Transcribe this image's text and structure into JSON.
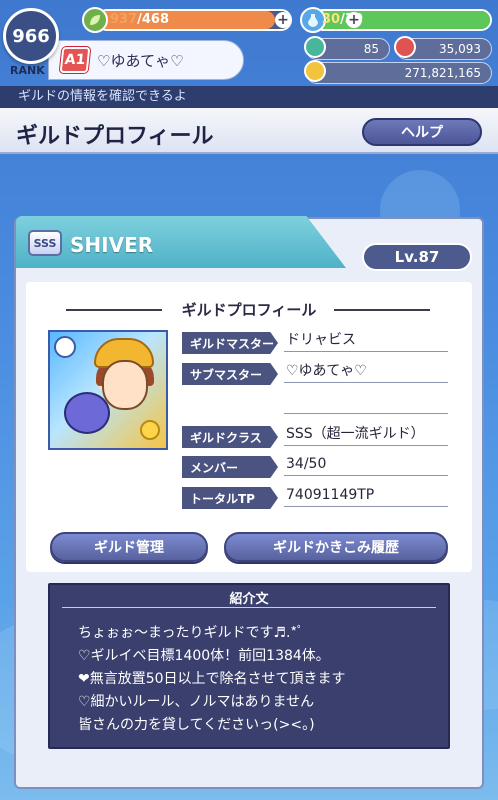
{
  "status": {
    "rank_value": "966",
    "rank_label": "RANK",
    "rank_badge": "A1",
    "player_name": "♡ゆあてゃ♡",
    "stamina_current": "937",
    "stamina_max": "/468",
    "stamina_fill": 0.92,
    "energy_current": "30",
    "energy_max": "/30",
    "energy_fill": 1.0,
    "gems": "85",
    "rubies": "35,093",
    "coins": "271,821,165",
    "plus_label": "+"
  },
  "notice": "ギルドの情報を確認できるよ",
  "header": {
    "title": "ギルドプロフィール",
    "help_label": "ヘルプ"
  },
  "guild": {
    "class_badge": "SSS",
    "name": "SHIVER",
    "level": "Lv.87"
  },
  "profile": {
    "section_title": "ギルドプロフィール",
    "fields": [
      {
        "label": "ギルドマスター",
        "value": "ドリャビス"
      },
      {
        "label": "サブマスター",
        "value": "♡ゆあてゃ♡"
      },
      {
        "label": "ギルドクラス",
        "value": "SSS（超一流ギルド）"
      },
      {
        "label": "メンバー",
        "value": "34/50"
      },
      {
        "label": "トータルTP",
        "value": "74091149TP"
      }
    ]
  },
  "actions": {
    "manage_label": "ギルド管理",
    "board_history_label": "ギルドかきこみ履歴"
  },
  "intro": {
    "title": "紹介文",
    "lines": [
      "ちょぉぉ〜まったりギルドです♬.*ﾟ",
      "♡ギルイベ目標1400体！前回1384体。",
      "❤無言放置50日以上で除名させて頂きます",
      "♡細かいルール、ノルマはありません",
      "皆さんの力を貸してくださいっ(><。)"
    ]
  },
  "colors": {
    "stamina": "#f08a4b",
    "energy": "#5cc85c",
    "primary_button": "#5e69a8",
    "intro_bg": "#3a3f6d"
  },
  "icons": {
    "stamina": "leaf-icon",
    "energy": "potion-icon",
    "gems": "gem-icon",
    "rubies": "ruby-icon",
    "coins": "coin-icon"
  }
}
